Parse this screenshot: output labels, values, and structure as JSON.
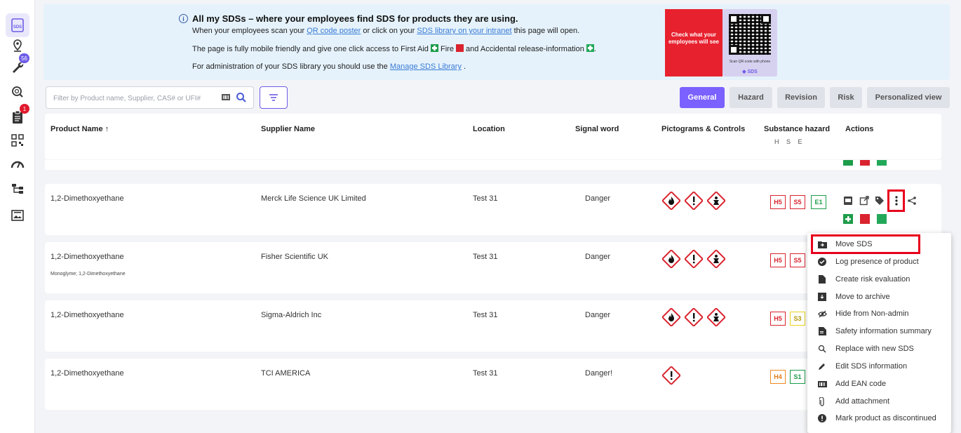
{
  "sidebar": {
    "badges": {
      "tools": "56",
      "clipboard": "1"
    },
    "sds_label": "SDS"
  },
  "banner": {
    "title": "All my SDSs – where your employees find SDS for products they are using.",
    "line1_a": "When your employees scan your ",
    "line1_link1": "QR code poster",
    "line1_b": " or click on your ",
    "line1_link2": "SDS library on your intranet",
    "line1_c": " this page will open.",
    "line2_a": "The page is fully mobile friendly and give one click access to First Aid ",
    "line2_b": " Fire ",
    "line2_c": " and Accidental release-information ",
    "line2_d": ".",
    "line3_a": "For administration of your SDS library you should use the ",
    "line3_link": "Manage SDS Library",
    "line3_b": " .",
    "promo_text": "Check what your employees will see",
    "qr_caption": "Scan QR-code with phone",
    "qr_brand": "SDS"
  },
  "search": {
    "placeholder": "Filter by Product name, Supplier, CAS# or UFI#"
  },
  "tabs": [
    "General",
    "Hazard",
    "Revision",
    "Risk",
    "Personalized view"
  ],
  "columns": {
    "product": "Product Name ↑",
    "supplier": "Supplier Name",
    "location": "Location",
    "signal": "Signal word",
    "pictograms": "Pictograms & Controls",
    "substance": "Substance hazard",
    "substance_sub": "H S E",
    "actions": "Actions"
  },
  "rows": [
    {
      "product": "1,2-Dimethoxyethane",
      "sub": "",
      "supplier": "Merck Life Science UK Limited",
      "location": "Test 31",
      "signal": "Danger",
      "hazards": [
        "H5",
        "S5",
        "E1"
      ]
    },
    {
      "product": "1,2-Dimethoxyethane",
      "sub": "Monoglyme; 1,2-Dimethoxyethane",
      "supplier": "Fisher Scientific UK",
      "location": "Test 31",
      "signal": "Danger",
      "hazards": [
        "H5",
        "S5"
      ]
    },
    {
      "product": "1,2-Dimethoxyethane",
      "sub": "",
      "supplier": "Sigma-Aldrich Inc",
      "location": "Test 31",
      "signal": "Danger",
      "hazards": [
        "H5",
        "S3"
      ]
    },
    {
      "product": "1,2-Dimethoxyethane",
      "sub": "",
      "supplier": "TCI AMERICA",
      "location": "Test 31",
      "signal": "Danger!",
      "hazards": [
        "H4",
        "S1"
      ]
    }
  ],
  "menu": [
    {
      "label": "Move SDS",
      "icon": "folder-move-icon"
    },
    {
      "label": "Log presence of product",
      "icon": "check-circle-icon"
    },
    {
      "label": "Create risk evaluation",
      "icon": "file-icon"
    },
    {
      "label": "Move to archive",
      "icon": "archive-icon"
    },
    {
      "label": "Hide from Non-admin",
      "icon": "eye-off-icon"
    },
    {
      "label": "Safety information summary",
      "icon": "summary-file-icon"
    },
    {
      "label": "Replace with new SDS",
      "icon": "replace-search-icon"
    },
    {
      "label": "Edit SDS information",
      "icon": "pencil-icon"
    },
    {
      "label": "Add EAN code",
      "icon": "barcode-icon"
    },
    {
      "label": "Add attachment",
      "icon": "paperclip-icon"
    },
    {
      "label": "Mark product as discontinued",
      "icon": "alert-circle-icon"
    }
  ],
  "colors": {
    "accent": "#7b61ff",
    "danger": "#d9232e",
    "green": "#1d9c4a",
    "highlight": "#e8001c"
  }
}
